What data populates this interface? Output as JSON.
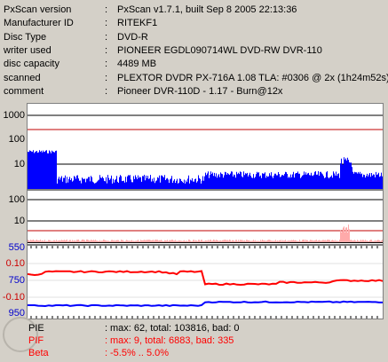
{
  "info": [
    {
      "key": "PxScan version",
      "value": "PxScan v1.7.1, built Sep  8 2005 22:13:36"
    },
    {
      "key": "Manufacturer ID",
      "value": "RITEKF1"
    },
    {
      "key": "Disc Type",
      "value": "DVD-R"
    },
    {
      "key": "writer used",
      "value": "PIONEER EGDL090714WL DVD-RW DVR-110"
    },
    {
      "key": "disc capacity",
      "value": "4489 MB"
    },
    {
      "key": "scanned",
      "value": "PLEXTOR DVDR PX-716A 1.08 TLA: #0306 @ 2x (1h24m52s)"
    },
    {
      "key": "comment",
      "value": "Pioneer DVR-110D - 1.17 - Burn@12x"
    }
  ],
  "colon": ":",
  "pie_axis": [
    "1000",
    "100",
    "10"
  ],
  "pif_axis": [
    "100",
    "10"
  ],
  "beta_axis": [
    "550",
    "0.10",
    "750",
    "-0.10",
    "950"
  ],
  "legend": [
    {
      "name": "PIE",
      "colon": ":",
      "value": "max: 62, total: 103816, bad: 0",
      "color": "#000000"
    },
    {
      "name": "PIF",
      "colon": ":",
      "value": "max: 9, total: 6883, bad: 335",
      "color": "#ff0000"
    },
    {
      "name": "Beta",
      "colon": ":",
      "value": "-5.5% .. 5.0%",
      "color": "#ff0000"
    }
  ],
  "colors": {
    "pie": "#0000ff",
    "pif": "#ff0000",
    "beta_red": "#ff0000",
    "beta_blue": "#0000ff",
    "threshold": "#c00000",
    "axis_blue": "#0000cc",
    "axis_red": "#cc0000"
  }
}
